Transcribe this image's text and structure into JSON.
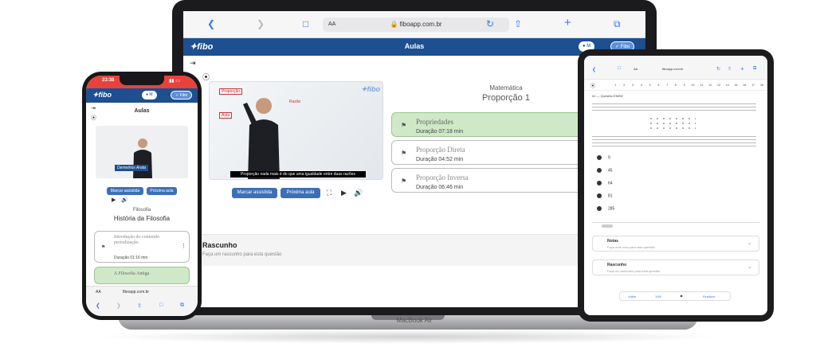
{
  "laptop": {
    "label": "MacBook Air",
    "browser": {
      "aa": "AA",
      "url": "fiboapp.com.br"
    },
    "header": {
      "logo": "fibo",
      "title": "Aulas",
      "user_label": "M",
      "fibo_label": "Fibo"
    },
    "video": {
      "caption": "Proporção nada mais é do que uma igualdade entre duas razões",
      "board_marks": [
        "Proporção",
        "Razão",
        "Aula"
      ]
    },
    "actions": {
      "mark_watched": "Marcar assistida",
      "next_class": "Próxima aula"
    },
    "subject": {
      "area": "Matemática",
      "topic": "Proporção 1"
    },
    "lessons": [
      {
        "title": "Propriedades",
        "duration": "Duração 07:18 min",
        "active": true
      },
      {
        "title": "Proporção Direta",
        "duration": "Duração 04:52 min",
        "active": false
      },
      {
        "title": "Proporção Inversa",
        "duration": "Duração 06:46 min",
        "active": false
      }
    ],
    "draft": {
      "title": "Rascunho",
      "placeholder": "Faça um rascunho para esta questão"
    }
  },
  "phone": {
    "status": {
      "time": "23:38"
    },
    "header": {
      "logo": "fibo",
      "user_label": "M",
      "fibo_label": "Fibo"
    },
    "page_title": "Aulas",
    "video_banner": "Demetrius Arata",
    "actions": {
      "mark_watched": "Marcar assistida",
      "next_class": "Próxima aula"
    },
    "subject": {
      "area": "Filosofia",
      "topic": "História da Filosofia"
    },
    "lessons": [
      {
        "title": "Introdução do conteúdo periodização",
        "duration": "Duração 01:16 min",
        "active": false
      },
      {
        "title": "A Filosofia Antiga",
        "duration": "",
        "active": true
      }
    ],
    "browser": {
      "aa": "AA",
      "url": "fiboapp.com.br"
    }
  },
  "tablet": {
    "browser": {
      "aa": "AA",
      "url": "fiboapp.com.br"
    },
    "question_numbers": [
      "1",
      "2",
      "3",
      "4",
      "5",
      "6",
      "7",
      "8",
      "9",
      "10",
      "11",
      "12",
      "13",
      "14",
      "15",
      "16",
      "17",
      "18"
    ],
    "question_title": "#1 — Questão ENEM",
    "options": [
      "9",
      "45",
      "64",
      "81",
      "285"
    ],
    "cards": [
      {
        "title": "Notas",
        "subtitle": "Faça uma nota para esta questão"
      },
      {
        "title": "Rascunho",
        "subtitle": "Faça um rascunho para esta questão"
      }
    ],
    "footer": {
      "back": "Voltar",
      "count": "1/45",
      "finish": "Finalizar"
    }
  }
}
